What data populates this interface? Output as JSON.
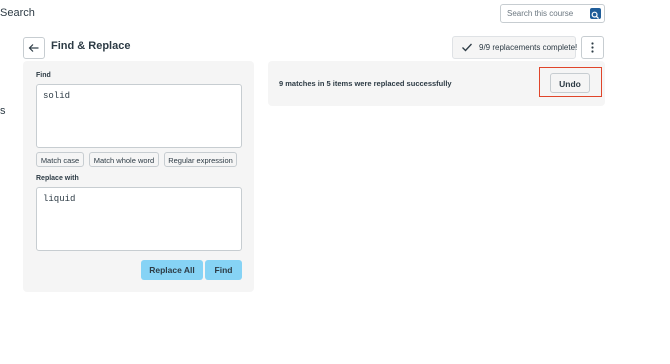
{
  "header": {
    "search_label": "Search",
    "search_placeholder": "Search this course"
  },
  "side": {
    "clipped_text": "s"
  },
  "page": {
    "title": "Find & Replace"
  },
  "status": {
    "text": "9/9 replacements complete!"
  },
  "find": {
    "label": "Find",
    "value": "solid",
    "options": [
      "Match case",
      "Match whole word",
      "Regular expression"
    ]
  },
  "replace": {
    "label": "Replace with",
    "value": "liquid"
  },
  "actions": {
    "replace_all": "Replace All",
    "find": "Find"
  },
  "result": {
    "message": "9 matches in 5 items were replaced successfully",
    "undo": "Undo"
  },
  "colors": {
    "primary_button": "#86d3f5",
    "search_button": "#1f5d99",
    "highlight": "#e0452a",
    "panel_bg": "#f5f5f5"
  }
}
